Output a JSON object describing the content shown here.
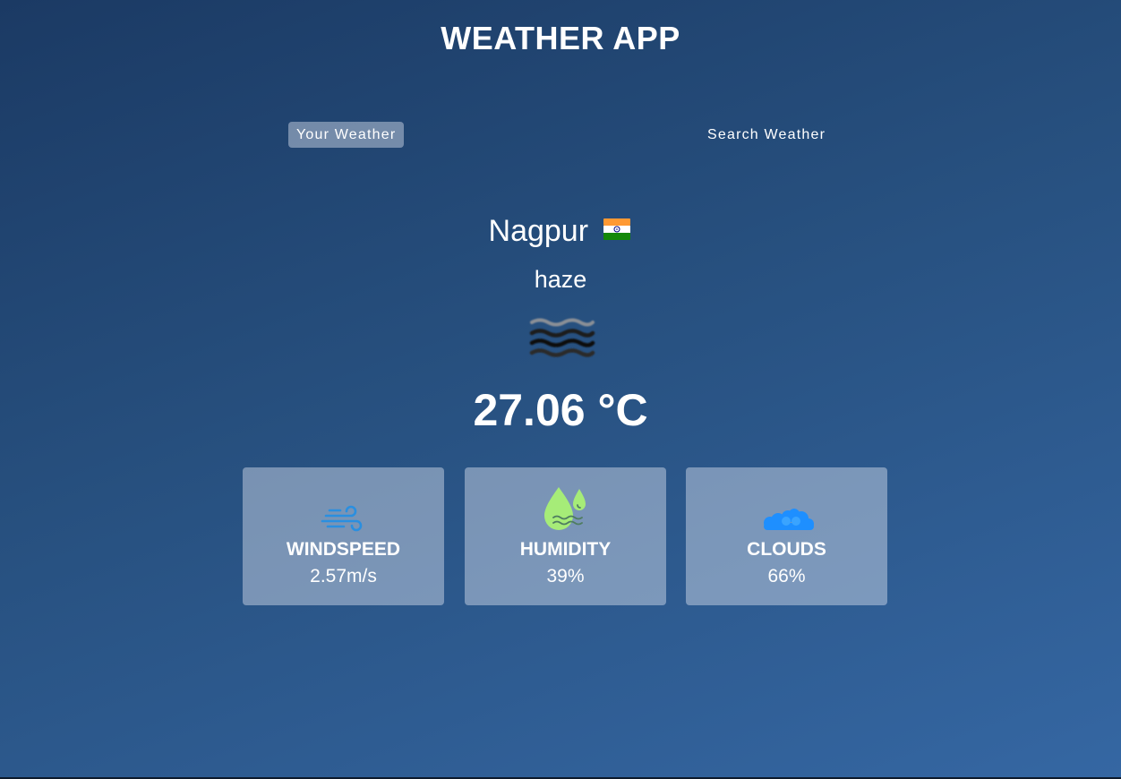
{
  "app": {
    "title": "WEATHER APP"
  },
  "tabs": [
    {
      "label": "Your Weather",
      "active": true
    },
    {
      "label": "Search Weather",
      "active": false
    }
  ],
  "weather": {
    "city": "Nagpur",
    "country_flag_icon": "india-flag-icon",
    "condition": "haze",
    "condition_icon": "haze-icon",
    "temperature": "27.06 °C"
  },
  "stats": [
    {
      "label": "WINDSPEED",
      "value": "2.57m/s",
      "icon": "wind-icon"
    },
    {
      "label": "HUMIDITY",
      "value": "39%",
      "icon": "humidity-icon"
    },
    {
      "label": "CLOUDS",
      "value": "66%",
      "icon": "clouds-icon"
    }
  ],
  "colors": {
    "background_top": "#1b3a64",
    "background_bottom": "#3567a3",
    "card_bg": "rgba(219,226,239,0.45)",
    "text": "#ffffff",
    "wind_icon": "#2a8fe0",
    "humidity_icon": "#a6ec78",
    "clouds_icon": "#1e8fff"
  }
}
